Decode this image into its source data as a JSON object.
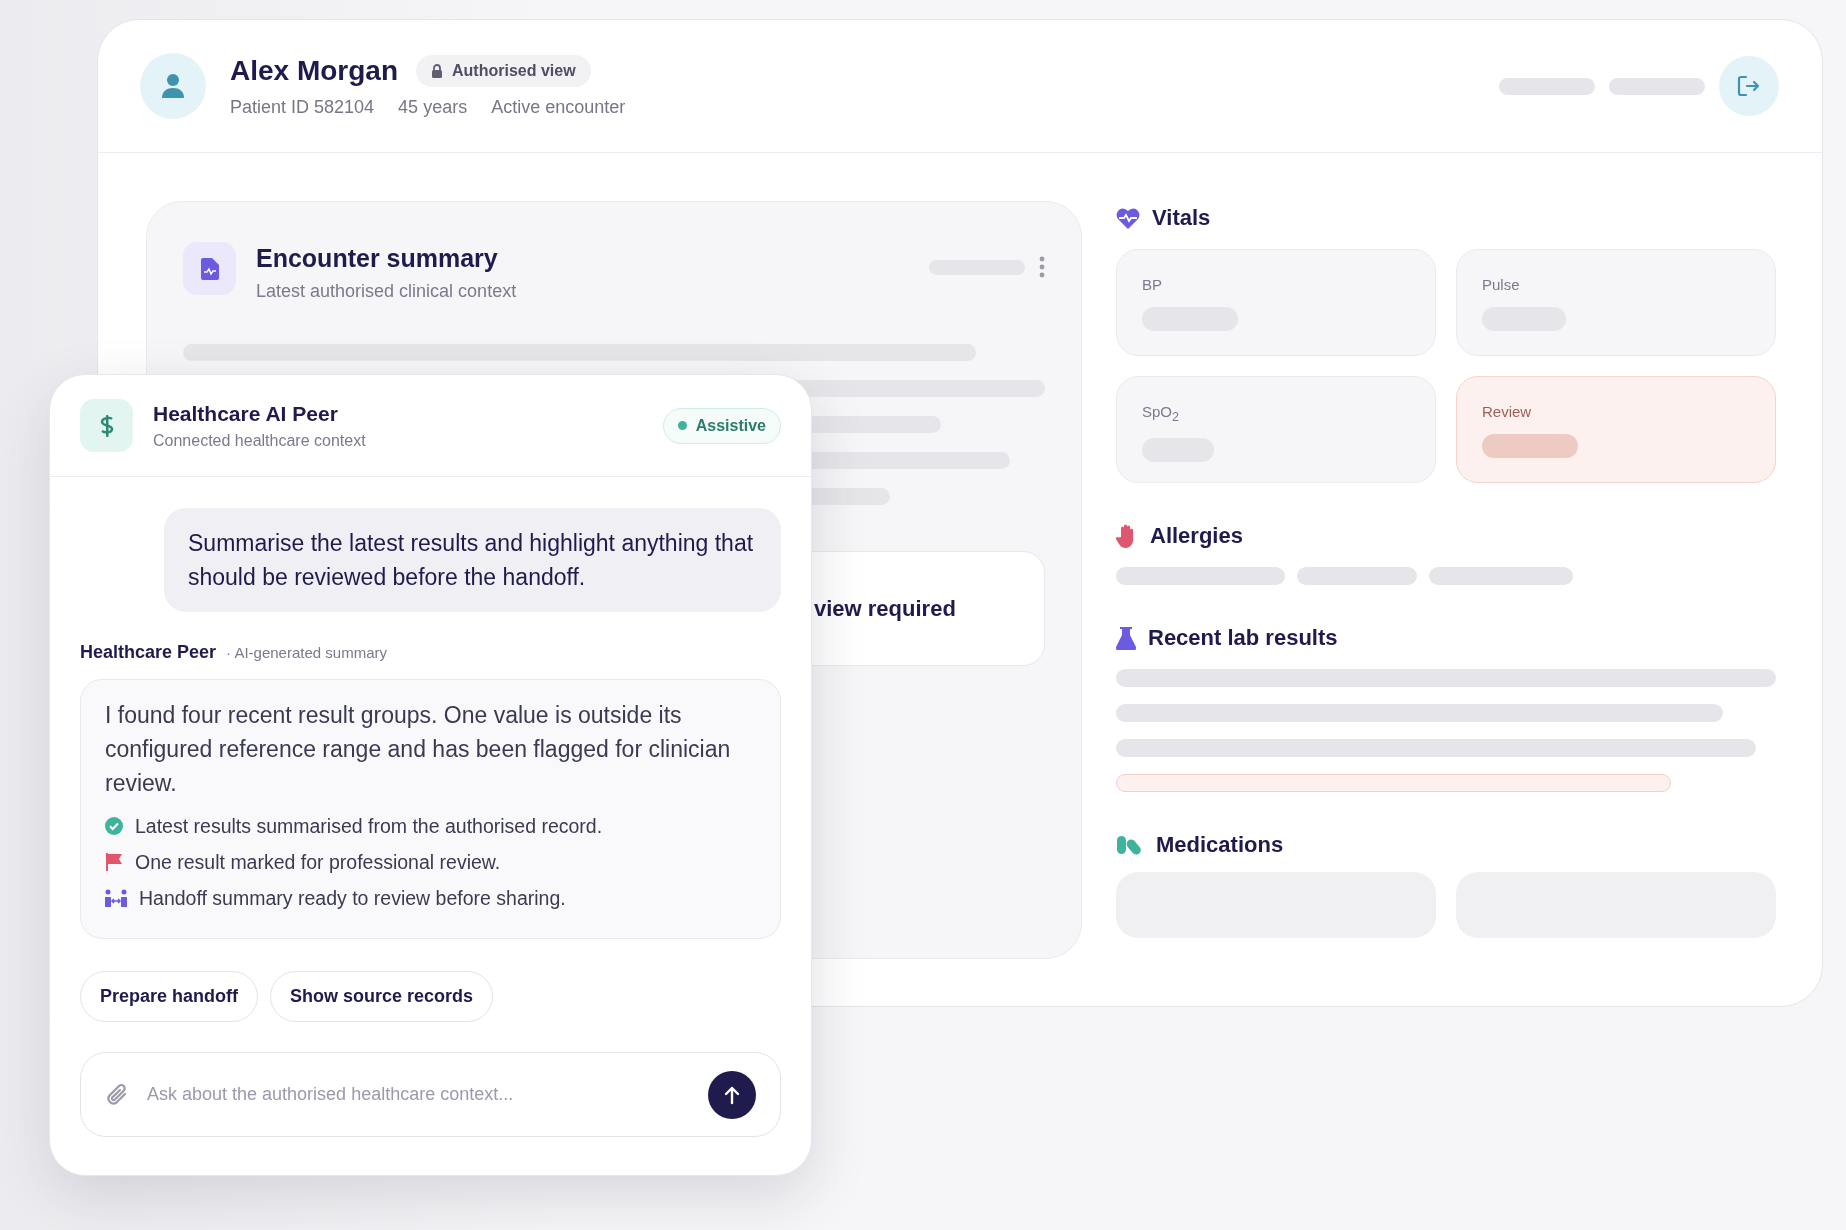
{
  "patient": {
    "name": "Alex Morgan",
    "access_badge": "Authorised view",
    "meta": [
      "Patient ID 582104",
      "45 years",
      "Active encounter"
    ]
  },
  "encounter": {
    "title": "Encounter summary",
    "subtitle": "Latest authorised clinical context",
    "notice": "view required"
  },
  "sections": [
    {
      "kind": "vitals",
      "title": "Vitals",
      "cards": [
        {
          "label": "BP",
          "flagged": false
        },
        {
          "label": "Pulse",
          "flagged": false
        },
        {
          "label": "SpO$_{2}$",
          "flagged": false
        },
        {
          "label": "Review",
          "flagged": true
        }
      ]
    },
    {
      "kind": "allergies",
      "title": "Allergies"
    },
    {
      "kind": "labs",
      "title": "Recent lab results",
      "rows": [
        {
          "flagged": false
        },
        {
          "flagged": false
        },
        {
          "flagged": false
        },
        {
          "flagged": true
        }
      ]
    },
    {
      "kind": "medications",
      "title": "Medications"
    }
  ],
  "chat": {
    "title": "Healthcare AI Peer",
    "subtitle": "Connected healthcare context",
    "status": {
      "label": "Assistive",
      "active": true
    },
    "user_message": "Summarise the latest results and highlight anything that should be reviewed before the handoff.",
    "assistant_name": "Healthcare Peer",
    "assistant_tag": "· AI-generated summary",
    "response": "I found four recent result groups. One value is outside its configured reference range and has been flagged for clinician review.",
    "points": [
      {
        "kind": "check",
        "text": "Latest results summarised from the authorised record."
      },
      {
        "kind": "flag",
        "text": "One result marked for professional review."
      },
      {
        "kind": "handoff",
        "text": "Handoff summary ready to review before sharing."
      }
    ],
    "actions": [
      "Prepare handoff",
      "Show source records"
    ],
    "input": {
      "placeholder": "Ask about the authorised healthcare context..."
    }
  }
}
